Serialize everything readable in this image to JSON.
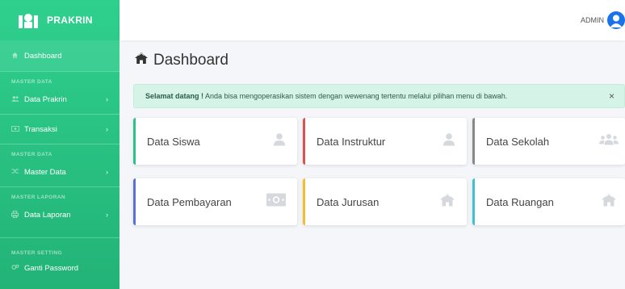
{
  "brand": {
    "name": "PRAKRIN"
  },
  "sidebar": {
    "dashboard": "Dashboard",
    "h_master_data_1": "MASTER DATA",
    "data_prakrin": "Data Prakrin",
    "transaksi": "Transaksi",
    "h_master_data_2": "MASTER DATA",
    "master_data": "Master Data",
    "h_master_laporan": "MASTER LAPORAN",
    "data_laporan": "Data Laporan",
    "h_master_setting": "MASTER SETTING",
    "ganti_password": "Ganti Password"
  },
  "topbar": {
    "user": "ADMIN"
  },
  "page": {
    "title": "Dashboard"
  },
  "alert": {
    "bold": "Selamat datang !",
    "text": " Anda bisa mengoperasikan sistem dengan wewenang tertentu melalui pilihan menu di bawah.",
    "close": "×"
  },
  "cards": [
    {
      "label": "Data Siswa",
      "accent": "#2fbf8a"
    },
    {
      "label": "Data Instruktur",
      "accent": "#d9534f"
    },
    {
      "label": "Data Sekolah",
      "accent": "#888888"
    },
    {
      "label": "Data Pembayaran",
      "accent": "#5b6fd6"
    },
    {
      "label": "Data Jurusan",
      "accent": "#f0c030"
    },
    {
      "label": "Data Ruangan",
      "accent": "#3ec1d3"
    }
  ]
}
